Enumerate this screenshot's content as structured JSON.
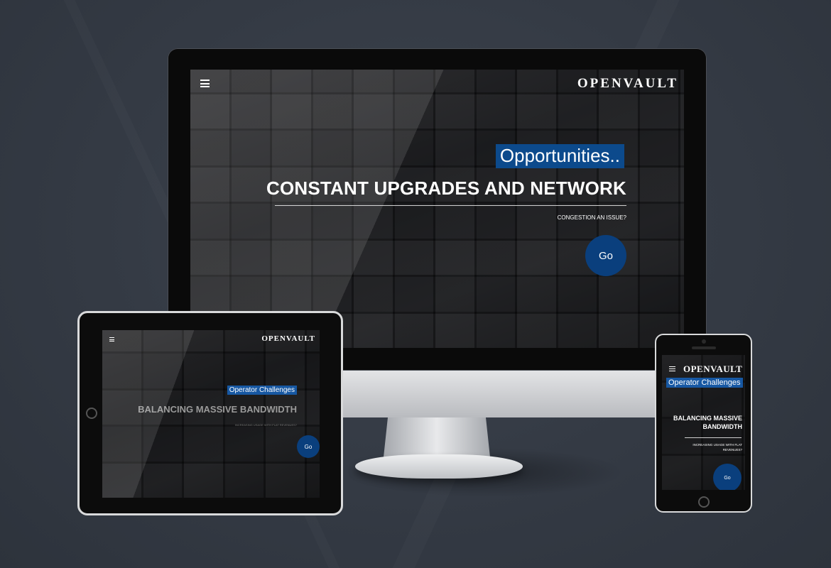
{
  "desktop": {
    "logo": "OPENVAULT",
    "highlight": "Opportunities..",
    "headline": "CONSTANT UPGRADES AND NETWORK",
    "subtext": "CONGESTION AN ISSUE?",
    "cta": "Go",
    "menu_icon": "hamburger-menu-icon"
  },
  "tablet": {
    "logo": "OPENVAULT",
    "highlight": "Operator Challenges",
    "headline": "BALANCING MASSIVE BANDWIDTH",
    "subtext": "INCREASING USAGE WITH FLAT REVENUES?",
    "cta": "Go",
    "menu_icon": "hamburger-menu-icon"
  },
  "phone": {
    "logo": "OPENVAULT",
    "highlight": "Operator Challenges",
    "headline_line1": "BALANCING MASSIVE",
    "headline_line2": "BANDWIDTH",
    "subtext_line1": "INCREASING USAGE WITH FLAT",
    "subtext_line2": "REVENUES?",
    "cta": "Go",
    "menu_icon": "hamburger-menu-icon"
  },
  "colors": {
    "accent_blue": "#0c4a8c",
    "background": "#343a44"
  }
}
